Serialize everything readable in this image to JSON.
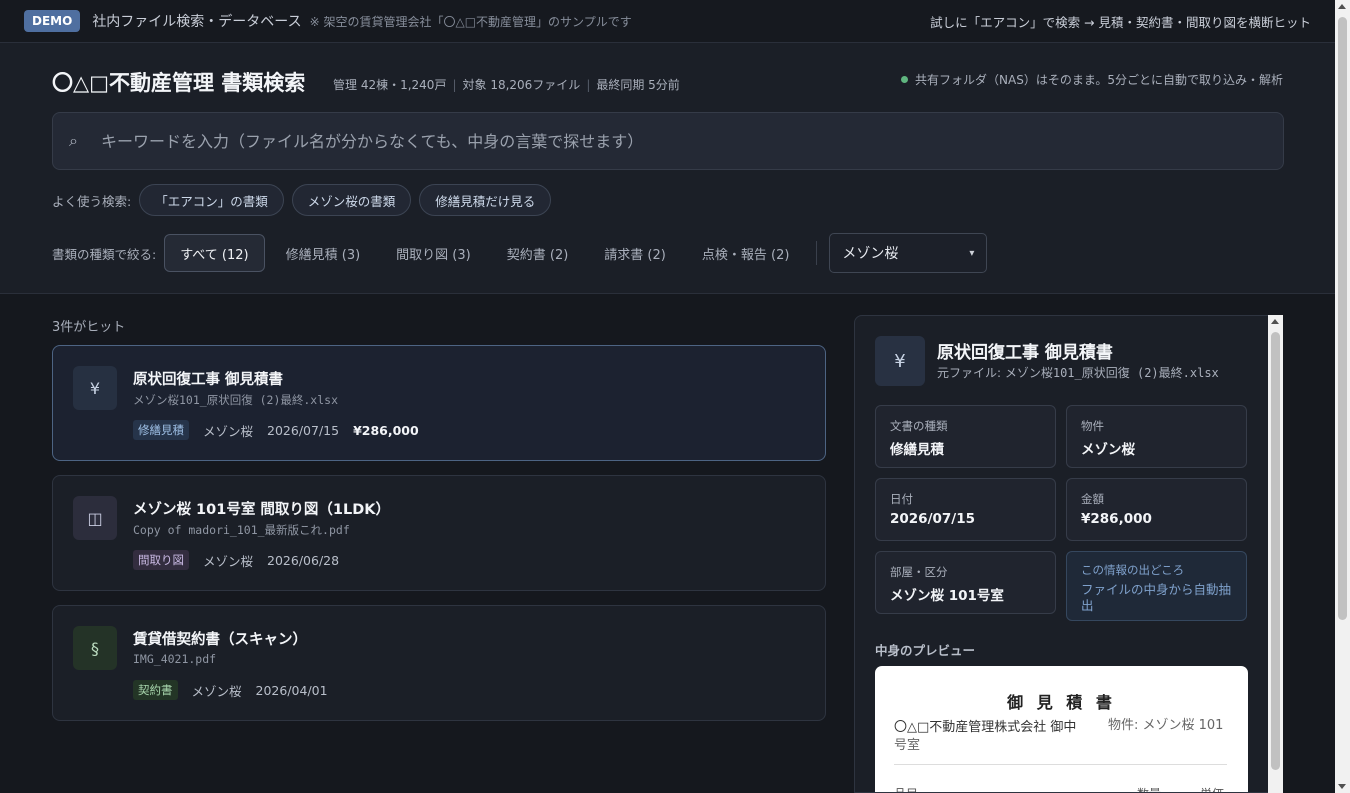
{
  "topbar": {
    "badge": "DEMO",
    "title": "社内ファイル検索・データベース",
    "note": "※ 架空の賃貸管理会社「〇△□不動産管理」のサンプルです",
    "hint": "試しに「エアコン」で検索 → 見積・契約書・間取り図を横断ヒット"
  },
  "header": {
    "title": "〇△□不動産管理 書類検索",
    "meta": [
      "管理 42棟・1,240戸",
      "対象 18,206ファイル",
      "最終同期 5分前"
    ],
    "sync_status": "共有フォルダ（NAS）はそのまま。5分ごとに自動で取り込み・解析",
    "status_color": "#5fb57f"
  },
  "search": {
    "icon": "search-icon",
    "placeholder": "キーワードを入力（ファイル名が分からなくても、中身の言葉で探せます）"
  },
  "quick_search": {
    "label": "よく使う検索:",
    "chips": [
      "「エアコン」の書類",
      "メゾン桜の書類",
      "修繕見積だけ見る"
    ]
  },
  "filters": {
    "label": "書類の種類で絞る:",
    "tabs": [
      {
        "label": "すべて (12)",
        "active": true
      },
      {
        "label": "修繕見積 (3)",
        "active": false
      },
      {
        "label": "間取り図 (3)",
        "active": false
      },
      {
        "label": "契約書 (2)",
        "active": false
      },
      {
        "label": "請求書 (2)",
        "active": false
      },
      {
        "label": "点検・報告 (2)",
        "active": false
      }
    ],
    "property_select": "メゾン桜"
  },
  "results": {
    "count": "3件がヒット",
    "items": [
      {
        "icon": "¥",
        "title": "原状回復工事 御見積書",
        "file": "メゾン桜101_原状回復 (2)最終.xlsx",
        "tag": "修繕見積",
        "property": "メゾン桜",
        "date": "2026/07/15",
        "amount": "¥286,000"
      },
      {
        "icon": "◫",
        "title": "メゾン桜 101号室 間取り図（1LDK）",
        "file": "Copy of madori_101_最新版これ.pdf",
        "tag": "間取り図",
        "property": "メゾン桜",
        "date": "2026/06/28"
      },
      {
        "icon": "§",
        "title": "賃貸借契約書（スキャン）",
        "file": "IMG_4021.pdf",
        "tag": "契約書",
        "property": "メゾン桜",
        "date": "2026/04/01"
      }
    ]
  },
  "detail": {
    "icon": "¥",
    "title": "原状回復工事 御見積書",
    "file_label": "元ファイル: ",
    "file": "メゾン桜101_原状回復 (2)最終.xlsx",
    "fields": [
      {
        "label": "文書の種類",
        "value": "修繕見積"
      },
      {
        "label": "物件",
        "value": "メゾン桜"
      },
      {
        "label": "日付",
        "value": "2026/07/15"
      },
      {
        "label": "金額",
        "value": "¥286,000"
      },
      {
        "label": "部屋・区分",
        "value": "メゾン桜 101号室"
      },
      {
        "label": "この情報の出どころ",
        "value": "ファイルの中身から自動抽出"
      }
    ],
    "preview_label": "中身のプレビュー",
    "preview": {
      "title": "御 見 積 書",
      "to": "〇△□不動産管理株式会社 御中",
      "property": "物件: メゾン桜 101号室",
      "col_item": "品目",
      "col_qty": "数量",
      "col_price": "単価"
    }
  }
}
